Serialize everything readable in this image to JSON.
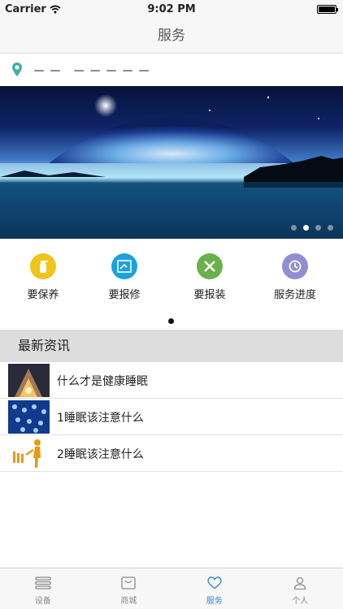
{
  "status_bar": {
    "carrier": "Carrier",
    "time": "9:02 PM"
  },
  "nav": {
    "title": "服务"
  },
  "location": {
    "address": "－－ －－－－－",
    "icon": "location-pin-icon"
  },
  "banner": {
    "page_count": 4,
    "active_page": 2
  },
  "services": [
    {
      "label": "要保养",
      "icon": "spray-bottle-icon",
      "color": "#f0c419"
    },
    {
      "label": "要报修",
      "icon": "repair-form-icon",
      "color": "#1aa1e0"
    },
    {
      "label": "要报装",
      "icon": "tools-icon",
      "color": "#6ab04c"
    },
    {
      "label": "服务进度",
      "icon": "clock-history-icon",
      "color": "#8e8fd0"
    }
  ],
  "news": {
    "header": "最新资讯",
    "items": [
      {
        "title": "什么才是健康睡眠"
      },
      {
        "title": "1睡眠该注意什么"
      },
      {
        "title": "2睡眠该注意什么"
      }
    ]
  },
  "tabs": [
    {
      "label": "设备",
      "icon": "list-icon"
    },
    {
      "label": "商城",
      "icon": "shopping-bag-icon"
    },
    {
      "label": "服务",
      "icon": "heart-icon"
    },
    {
      "label": "个人",
      "icon": "person-icon"
    }
  ],
  "colors": {
    "accent": "#3b8ad6",
    "header_bg": "#dddddd"
  }
}
